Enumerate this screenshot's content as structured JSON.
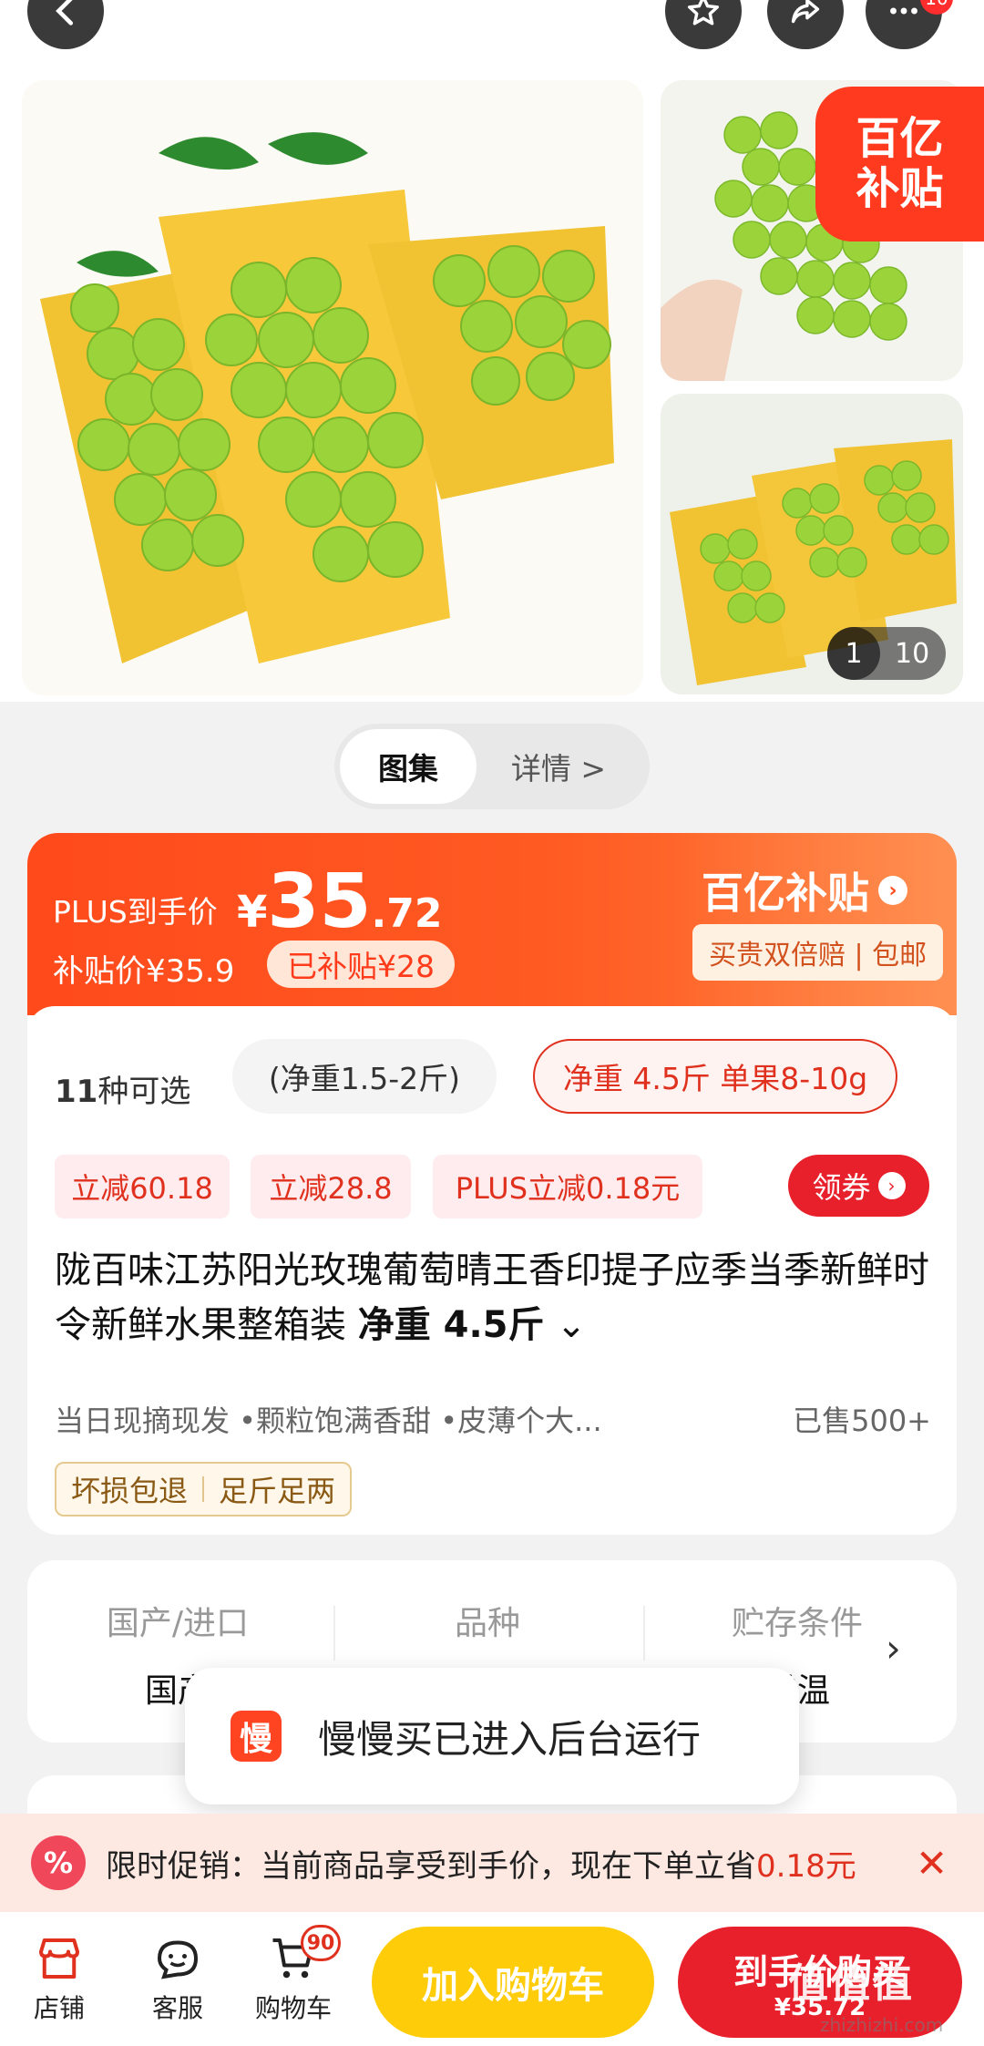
{
  "gallery": {
    "subsidy_tag_line1": "百亿",
    "subsidy_tag_line2": "补贴",
    "counter_current": "1",
    "counter_total": "10"
  },
  "notification_count": "10",
  "tabs": {
    "gallery_label": "图集",
    "detail_label": "详情 >"
  },
  "price": {
    "plus_label": "PLUS到手价",
    "currency": "¥",
    "integer": "35",
    "decimal": ".72",
    "subsidy_price": "补贴价¥35.9",
    "subsidized_tag": "已补贴¥28",
    "brand_logo": "百亿补贴",
    "brand_tags": "买贵双倍赔 | 包邮"
  },
  "options": {
    "count_num": "11",
    "count_text": "种可选",
    "option1": "(净重1.5-2斤)",
    "option2": "净重 4.5斤 单果8-10g"
  },
  "coupons": {
    "c1": "立减60.18",
    "c2": "立减28.8",
    "c3": "PLUS立减0.18元",
    "get_label": "领券"
  },
  "product": {
    "title": "陇百味江苏阳光玫瑰葡萄晴王香印提子应季当季新鲜时令新鲜水果整箱装 ",
    "weight": "净重 4.5斤",
    "features": "当日现摘现发 •颗粒饱满香甜 •皮薄个大...",
    "sold": "已售500+",
    "service_tag1": "坏损包退",
    "service_tag2": "足斤足两"
  },
  "attributes": [
    {
      "label": "国产/进口",
      "value": "国产"
    },
    {
      "label": "品种",
      "value": ""
    },
    {
      "label": "贮存条件",
      "value": "常温"
    }
  ],
  "toast": {
    "logo": "慢",
    "message": "慢慢买已进入后台运行"
  },
  "promo": {
    "icon": "%",
    "text": "限时促销：当前商品享受到手价，现在下单立省",
    "amount": "0.18元"
  },
  "bottom_bar": {
    "store_label": "店铺",
    "service_label": "客服",
    "cart_label": "购物车",
    "cart_badge": "90",
    "add_cart_label": "加入购物车",
    "buy_label": "到手价购买",
    "buy_price": "¥35.72"
  },
  "watermark": {
    "text": "值值值",
    "sub": "zhizhizhi.com"
  },
  "colors": {
    "accent_red": "#e8202b",
    "price_orange": "#ff4a1c",
    "cart_yellow": "#ffcc0a"
  }
}
